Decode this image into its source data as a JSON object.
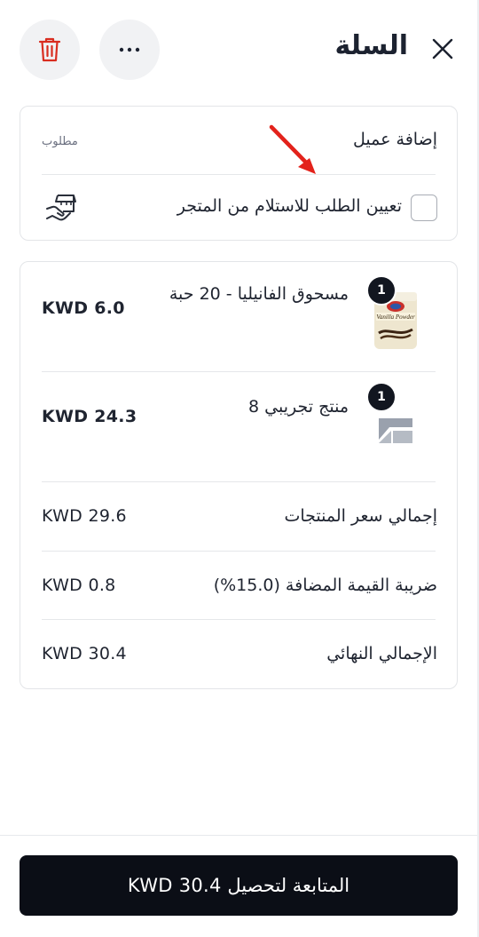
{
  "header": {
    "title": "السلة",
    "close_icon": "close-icon",
    "more_icon": "more-horizontal-icon",
    "delete_icon": "trash-icon",
    "delete_color": "#d92d20"
  },
  "customer": {
    "add_label": "إضافة عميل",
    "required_label": "مطلوب",
    "pickup_label": "تعيين الطلب للاستلام من المتجر",
    "pickup_checked": false,
    "store_icon": "store-hand-icon"
  },
  "items": [
    {
      "name": "مسحوق الفانيليا - 20 حبة",
      "price": "KWD 6.0",
      "quantity": "1",
      "thumbnail_label": "Vanilla Powder"
    },
    {
      "name": "منتج تجريبي 8",
      "price": "KWD 24.3",
      "quantity": "1",
      "thumbnail_label": ""
    }
  ],
  "summary": {
    "subtotal_label": "إجمالي سعر المنتجات",
    "subtotal_value": "KWD 29.6",
    "vat_label": "ضريبة القيمة المضافة (15.0%)",
    "vat_value": "KWD 0.8",
    "total_label": "الإجمالي النهائي",
    "total_value": "KWD 30.4"
  },
  "checkout": {
    "label": "المتابعة لتحصيل KWD 30.4"
  },
  "colors": {
    "accent_dark": "#0b0e16",
    "annotation_arrow": "#e3221b",
    "badge": "#121620"
  }
}
